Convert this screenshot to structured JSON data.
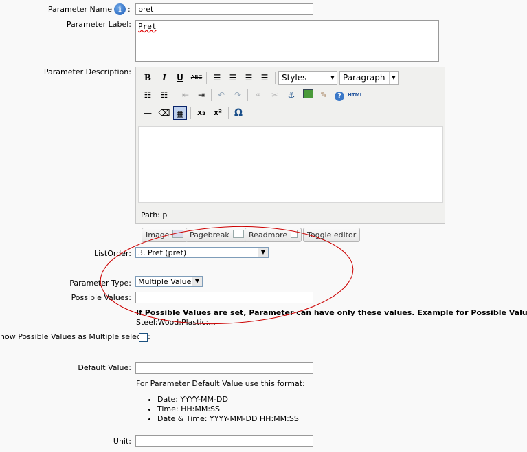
{
  "fields": {
    "name": {
      "label": "Parameter Name",
      "value": "pret",
      "colon": ":"
    },
    "label": {
      "label": "Parameter Label:",
      "value": "Pret"
    },
    "description": {
      "label": "Parameter Description:"
    },
    "list_order": {
      "label": "ListOrder:",
      "value": "3. Pret (pret)"
    },
    "type": {
      "label": "Parameter Type:",
      "value": "Multiple Values"
    },
    "possible_values": {
      "label": "Possible Values:",
      "value": ""
    },
    "multi_select": {
      "label": "how Possible Values as Multiple select?:",
      "checked": false
    },
    "default_value": {
      "label": "Default Value:",
      "value": ""
    },
    "unit": {
      "label": "Unit:",
      "value": ""
    }
  },
  "editor": {
    "styles_label": "Styles",
    "format_label": "Paragraph",
    "path_text": "Path: p",
    "toolbar": {
      "bold": "B",
      "italic": "I",
      "underline": "U",
      "strike": "ABC",
      "html": "HTML",
      "subscript": "x₂",
      "superscript": "x²",
      "omega": "Ω"
    }
  },
  "editor_buttons": {
    "image": "Image",
    "pagebreak": "Pagebreak",
    "readmore": "Readmore",
    "toggle": "Toggle editor"
  },
  "hints": {
    "possible_values_bold": "If Possible Values are set, Parameter can have only these values. Example for Possible Values:",
    "possible_values_example": "Steel;Wood;Plastic;...",
    "default_format_intro": "For Parameter Default Value use this format:",
    "formats": [
      "Date: YYYY-MM-DD",
      "Time: HH:MM:SS",
      "Date & Time: YYYY-MM-DD HH:MM:SS"
    ]
  },
  "annotation_color": "#cc0000"
}
